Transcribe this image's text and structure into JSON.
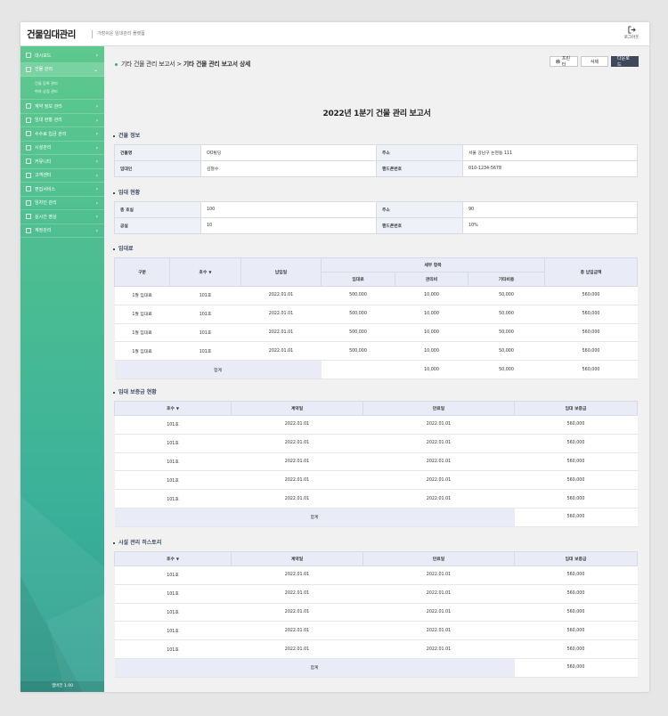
{
  "header": {
    "logo_title": "건물임대관리",
    "logo_subtitle": "가장쉬운 임대관리 플랫폼",
    "logout_label": "로그아웃"
  },
  "sidebar": {
    "items": [
      {
        "label": "대시보드",
        "icon": "dashboard-icon"
      },
      {
        "label": "건물 관리",
        "icon": "building-icon",
        "active": true
      },
      {
        "label": "계약 정보 관리",
        "icon": "contract-icon"
      },
      {
        "label": "임대 현황 관리",
        "icon": "status-icon"
      },
      {
        "label": "수수료 입금 관리",
        "icon": "deposit-icon"
      },
      {
        "label": "시설관리",
        "icon": "facility-icon"
      },
      {
        "label": "커뮤니티",
        "icon": "community-icon"
      },
      {
        "label": "고객센터",
        "icon": "support-icon"
      },
      {
        "label": "편집서비스",
        "icon": "edit-icon"
      },
      {
        "label": "임차인 관리",
        "icon": "tenant-icon"
      },
      {
        "label": "실시간 영상",
        "icon": "video-icon"
      },
      {
        "label": "계정관리",
        "icon": "account-icon"
      }
    ],
    "submenu": [
      "건물 등록 관리",
      "취약 상점 관리"
    ],
    "version": "앱버전 1.00"
  },
  "breadcrumb": {
    "parent": "기타 건물 관리 보고서",
    "separator": ">",
    "current": "기타 건물 관리 보고서 상세"
  },
  "actions": {
    "print": "프린터",
    "delete": "삭제",
    "download": "다운로드"
  },
  "report_title": "2022년 1분기 건물 관리 보고서",
  "building_info": {
    "section_title": "건물 정보",
    "rows": [
      [
        "건물명",
        "OO빌딩",
        "주소",
        "서울 강남구 논현동 111"
      ],
      [
        "임대인",
        "김철수",
        "핸드폰번호",
        "010-1234-5678"
      ]
    ]
  },
  "lease_status": {
    "section_title": "임대 현황",
    "rows": [
      [
        "총 호실",
        "100",
        "주소",
        "90"
      ],
      [
        "공실",
        "10",
        "핸드폰번호",
        "10%"
      ]
    ]
  },
  "rent": {
    "section_title": "임대료",
    "headers": {
      "type": "구분",
      "unit": "호수",
      "paid_date": "납입일",
      "detail": "세부 항목",
      "rent": "임대료",
      "mgmt": "관리비",
      "other": "기타비용",
      "total": "총 납입금액"
    },
    "rows": [
      [
        "1월 임대료",
        "101호",
        "2022.01.01",
        "500,000",
        "10,000",
        "50,000",
        "560,000"
      ],
      [
        "1월 임대료",
        "101호",
        "2022.01.01",
        "500,000",
        "10,000",
        "50,000",
        "560,000"
      ],
      [
        "1월 임대료",
        "101호",
        "2022.01.01",
        "500,000",
        "10,000",
        "50,000",
        "560,000"
      ],
      [
        "1월 임대료",
        "101호",
        "2022.01.01",
        "500,000",
        "10,000",
        "50,000",
        "560,000"
      ]
    ],
    "sum": {
      "label": "합계",
      "mgmt": "10,000",
      "other": "50,000",
      "total": "560,000"
    }
  },
  "deposit": {
    "section_title": "임대 보증금 현황",
    "headers": [
      "호수",
      "계약일",
      "만료일",
      "임대 보증금"
    ],
    "rows": [
      [
        "101호",
        "2022.01.01",
        "2022.01.01",
        "560,000"
      ],
      [
        "101호",
        "2022.01.01",
        "2022.01.01",
        "560,000"
      ],
      [
        "101호",
        "2022.01.01",
        "2022.01.01",
        "560,000"
      ],
      [
        "101호",
        "2022.01.01",
        "2022.01.01",
        "560,000"
      ],
      [
        "101호",
        "2022.01.01",
        "2022.01.01",
        "560,000"
      ]
    ],
    "sum": {
      "label": "합계",
      "total": "560,000"
    }
  },
  "facility": {
    "section_title": "시설 관리 히스토리",
    "headers": [
      "호수",
      "계약일",
      "만료일",
      "임대 보증금"
    ],
    "rows": [
      [
        "101호",
        "2022.01.01",
        "2022.01.01",
        "560,000"
      ],
      [
        "101호",
        "2022.01.01",
        "2022.01.01",
        "560,000"
      ],
      [
        "101호",
        "2022.01.01",
        "2022.01.01",
        "560,000"
      ],
      [
        "101호",
        "2022.01.01",
        "2022.01.01",
        "560,000"
      ],
      [
        "101호",
        "2022.01.01",
        "2022.01.01",
        "560,000"
      ]
    ],
    "sum": {
      "label": "합계",
      "total": "560,000"
    }
  },
  "colors": {
    "sidebar_top": "#5ec98e",
    "sidebar_bottom": "#2f9e8f",
    "accent": "#3aaa7c",
    "download_button": "#3e4a5c",
    "table_header": "#e9ecf6"
  }
}
